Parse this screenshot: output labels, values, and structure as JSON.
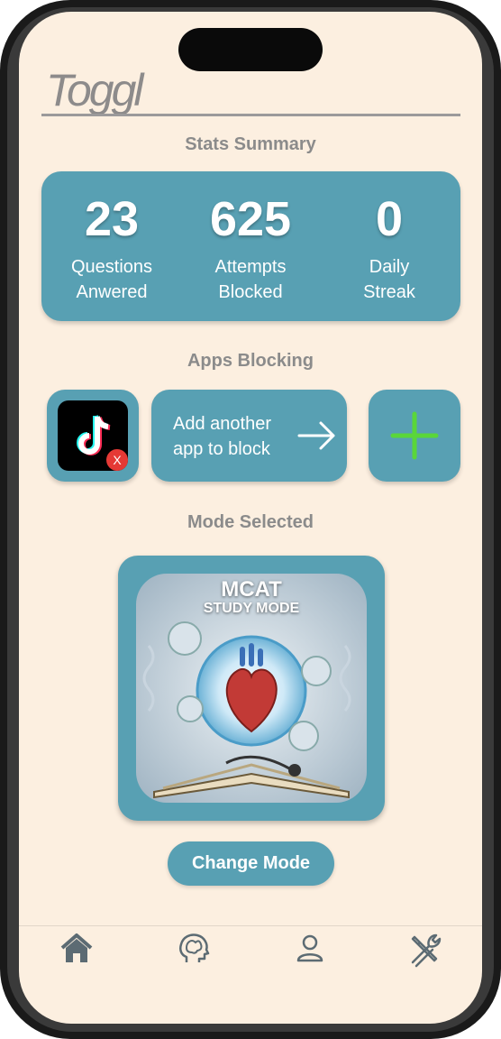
{
  "app": {
    "logo": "Toggl"
  },
  "stats": {
    "title": "Stats Summary",
    "items": [
      {
        "value": "23",
        "label_line1": "Questions",
        "label_line2": "Anwered"
      },
      {
        "value": "625",
        "label_line1": "Attempts",
        "label_line2": "Blocked"
      },
      {
        "value": "0",
        "label_line1": "Daily",
        "label_line2": "Streak"
      }
    ]
  },
  "apps": {
    "title": "Apps Blocking",
    "blocked": [
      {
        "icon": "tiktok-icon",
        "badge": "X"
      }
    ],
    "add_label_line1": "Add another",
    "add_label_line2": "app to block"
  },
  "mode": {
    "title": "Mode Selected",
    "image_title_line1": "MCAT",
    "image_title_line2": "STUDY MODE",
    "change_button": "Change Mode"
  },
  "tabbar": {
    "items": [
      {
        "icon": "home-icon"
      },
      {
        "icon": "brain-icon"
      },
      {
        "icon": "profile-icon"
      },
      {
        "icon": "tools-icon"
      }
    ]
  },
  "colors": {
    "background": "#fcefe0",
    "accent": "#58a0b3",
    "plus": "#5ad63a",
    "muted_text": "#8b8b8b"
  }
}
